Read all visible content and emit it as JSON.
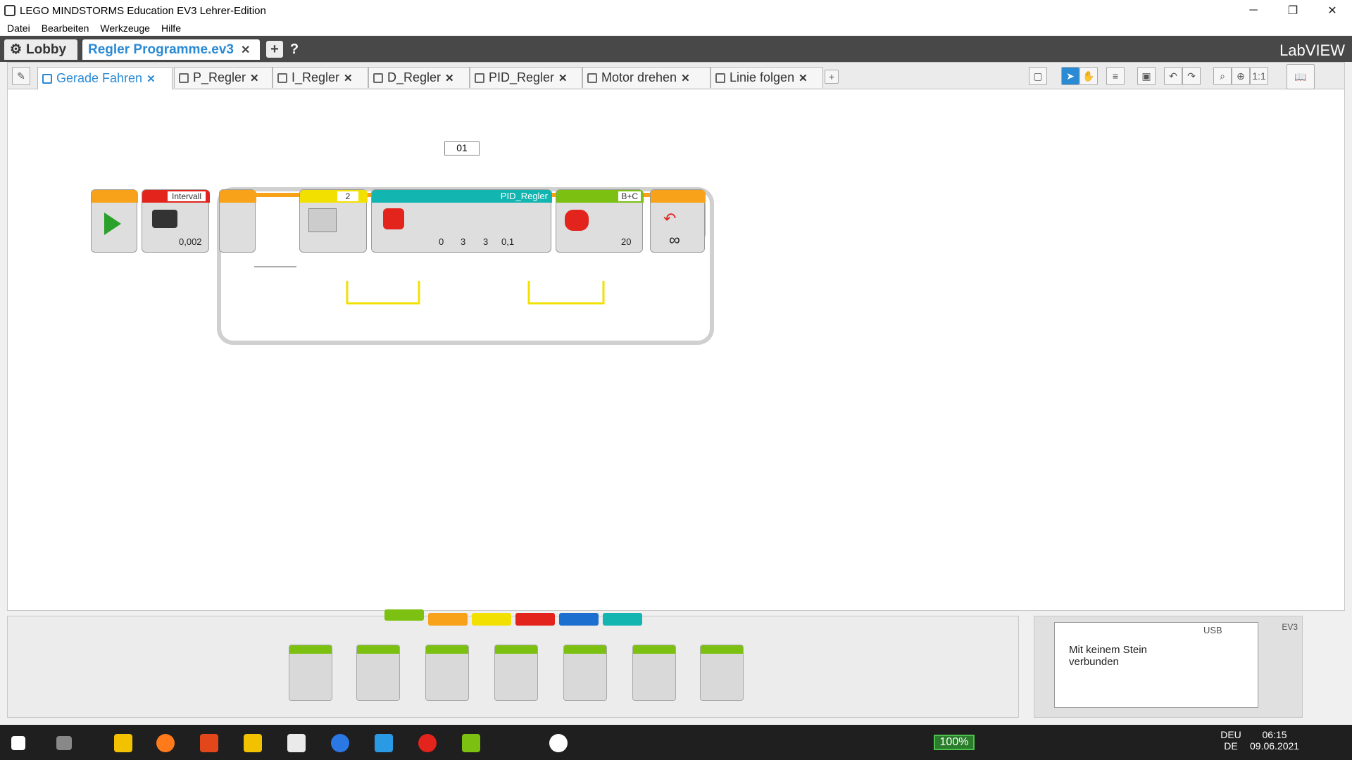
{
  "window": {
    "title": "LEGO MINDSTORMS Education EV3 Lehrer-Edition",
    "minimize": "─",
    "restore": "❐",
    "close": "✕"
  },
  "menu": [
    "Datei",
    "Bearbeiten",
    "Werkzeuge",
    "Hilfe"
  ],
  "project": {
    "lobby": "Lobby",
    "file": "Regler Programme.ev3",
    "add": "+",
    "help": "?",
    "brand": "LabVIEW"
  },
  "program_tabs": [
    {
      "label": "Gerade Fahren",
      "active": true
    },
    {
      "label": "P_Regler"
    },
    {
      "label": "I_Regler"
    },
    {
      "label": "D_Regler"
    },
    {
      "label": "PID_Regler"
    },
    {
      "label": "Motor drehen"
    },
    {
      "label": "Linie folgen"
    }
  ],
  "program": {
    "loop_label": "01",
    "wait_header": "Intervall",
    "wait_value": "0,002",
    "sensor_header": "2",
    "pid_header": "PID_Regler",
    "pid_values": [
      "0",
      "3",
      "3",
      "0,1"
    ],
    "steering_header": "B+C",
    "steering_power": "20",
    "loop_mode": "∞"
  },
  "palette": {
    "colors": [
      "#7cc012",
      "#f8a21a",
      "#f2e100",
      "#e2241c",
      "#1d6fcf",
      "#13b5b1"
    ]
  },
  "hardware": {
    "usb": "USB",
    "message": "Mit keinem Stein verbunden",
    "ev3": "EV3"
  },
  "taskbar": {
    "battery": "100%",
    "lang_top": "DEU",
    "lang_bottom": "DE",
    "time": "06:15",
    "date": "09.06.2021"
  }
}
